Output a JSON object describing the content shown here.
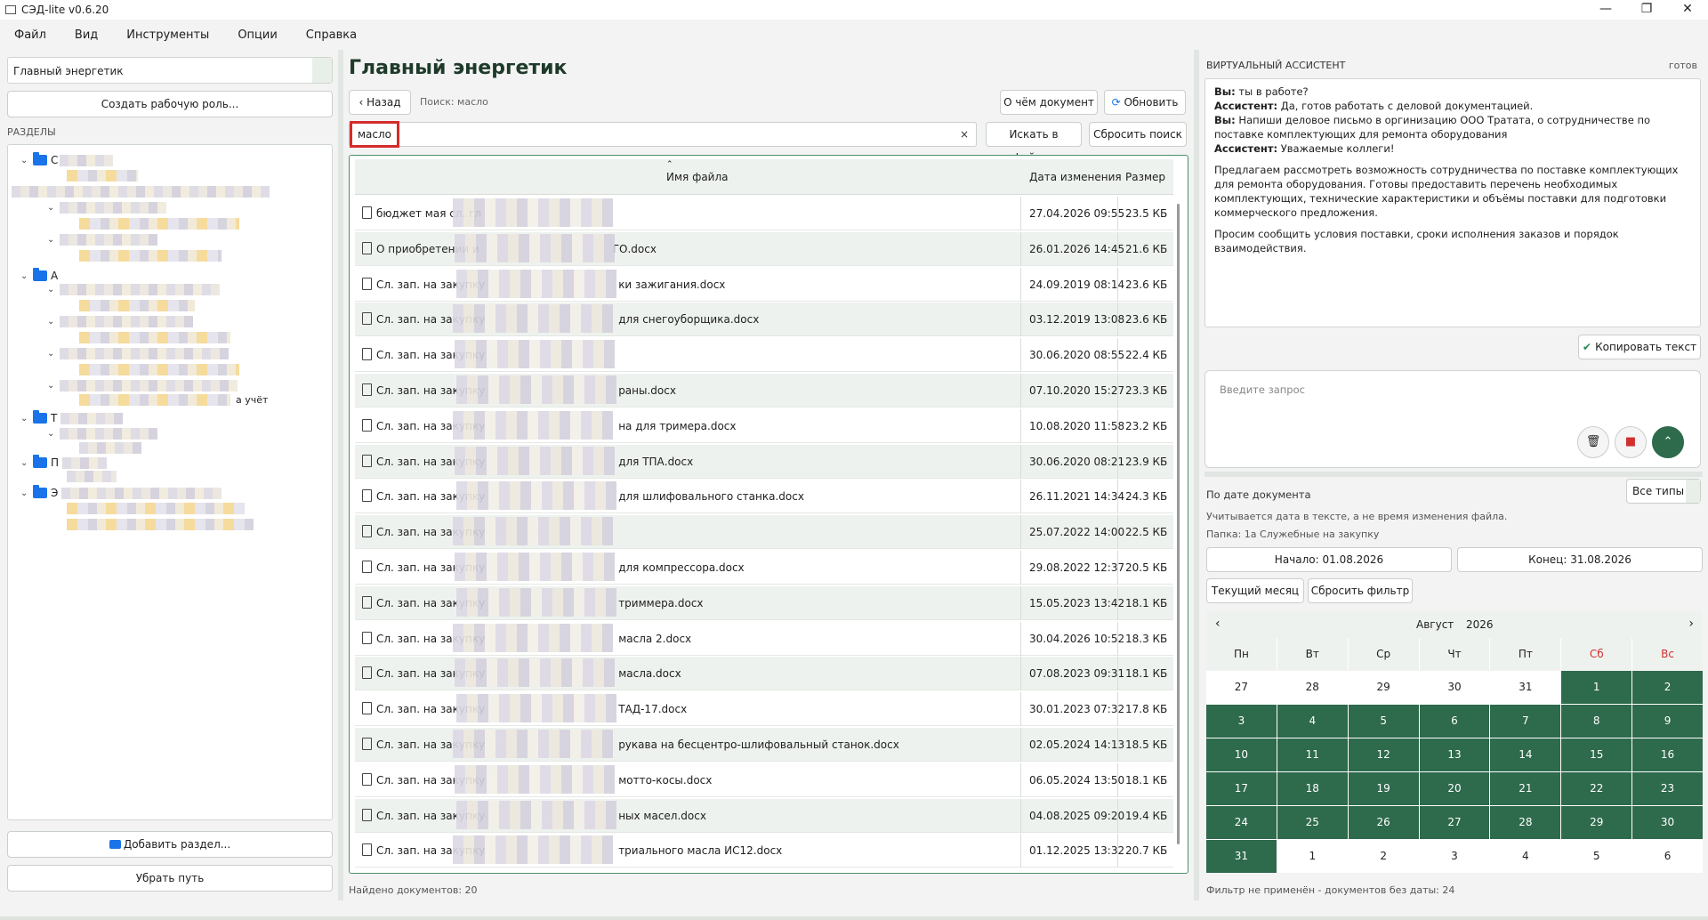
{
  "window": {
    "title": "СЭД-lite v0.6.20",
    "minimize": "—",
    "maximize": "❐",
    "close": "✕"
  },
  "menu": [
    "Файл",
    "Вид",
    "Инструменты",
    "Опции",
    "Справка"
  ],
  "left": {
    "role_value": "Главный энергетик",
    "create_role": "Создать рабочую роль...",
    "sections_label": "РАЗДЕЛЫ",
    "tree_fragments": [
      "С",
      "А",
      "Т",
      "П",
      "Э",
      "а учёт"
    ],
    "add_section": "Добавить раздел...",
    "remove_path": "Убрать путь"
  },
  "center": {
    "title": "Главный энергетик",
    "back": "Назад",
    "search_hint": "Поиск: масло",
    "about": "О чём документ",
    "refresh": "Обновить",
    "search_value": "масло",
    "clear": "×",
    "search_files": "Искать в файлах",
    "reset_search": "Сбросить поиск",
    "columns": {
      "name": "Имя файла",
      "date": "Дата изменения",
      "size": "Размер"
    },
    "rows": [
      {
        "prefix": "бюджет мая сл. гл",
        "suffix": "",
        "date": "27.04.2026 09:55",
        "size": "23.5 КБ"
      },
      {
        "prefix": "О приобретении и",
        "suffix": "ГО.docx",
        "date": "26.01.2026 14:45",
        "size": "21.6 КБ"
      },
      {
        "prefix": "Сл. зап. на закупку",
        "suffix": "ки зажигания.docx",
        "date": "24.09.2019 08:14",
        "size": "23.6 КБ"
      },
      {
        "prefix": "Сл. зап. на закупку",
        "suffix": "для снегоуборщика.docx",
        "date": "03.12.2019 13:08",
        "size": "23.6 КБ"
      },
      {
        "prefix": "Сл. зап. на закупку",
        "suffix": "",
        "date": "30.06.2020 08:55",
        "size": "22.4 КБ"
      },
      {
        "prefix": "Сл. зап. на закупку",
        "suffix": "раны.docx",
        "date": "07.10.2020 15:27",
        "size": "23.3 КБ"
      },
      {
        "prefix": "Сл. зап. на закупку",
        "suffix": "на для тримера.docx",
        "date": "10.08.2020 11:58",
        "size": "23.2 КБ"
      },
      {
        "prefix": "Сл. зап. на закупку",
        "suffix": "для ТПА.docx",
        "date": "30.06.2020 08:21",
        "size": "23.9 КБ"
      },
      {
        "prefix": "Сл. зап. на закупку",
        "suffix": "для шлифовального станка.docx",
        "date": "26.11.2021 14:34",
        "size": "24.3 КБ"
      },
      {
        "prefix": "Сл. зап. на закупку",
        "suffix": "",
        "date": "25.07.2022 14:00",
        "size": "22.5 КБ"
      },
      {
        "prefix": "Сл. зап. на закупку",
        "suffix": "для компрессора.docx",
        "date": "29.08.2022 12:37",
        "size": "20.5 КБ"
      },
      {
        "prefix": "Сл. зап. на закупку",
        "suffix": "триммера.docx",
        "date": "15.05.2023 13:42",
        "size": "18.1 КБ"
      },
      {
        "prefix": "Сл. зап. на закупку",
        "suffix": "масла 2.docx",
        "date": "30.04.2026 10:52",
        "size": "18.3 КБ"
      },
      {
        "prefix": "Сл. зап. на закупку",
        "suffix": "масла.docx",
        "date": "07.08.2023 09:31",
        "size": "18.1 КБ"
      },
      {
        "prefix": "Сл. зап. на закупку",
        "suffix": "ТАД-17.docx",
        "date": "30.01.2023 07:32",
        "size": "17.8 КБ"
      },
      {
        "prefix": "Сл. зап. на закупку",
        "suffix": "рукава на бесцентро-шлифовальный станок.docx",
        "date": "02.05.2024 14:13",
        "size": "18.5 КБ"
      },
      {
        "prefix": "Сл. зап. на закупку",
        "suffix": "мотто-косы.docx",
        "date": "06.05.2024 13:50",
        "size": "18.1 КБ"
      },
      {
        "prefix": "Сл. зап. на закупку",
        "suffix": "ных масел.docx",
        "date": "04.08.2025 09:20",
        "size": "19.4 КБ"
      },
      {
        "prefix": "Сл. зап. на закупку",
        "suffix": "триального масла ИС12.docx",
        "date": "01.12.2025 13:32",
        "size": "20.7 КБ"
      }
    ],
    "found": "Найдено документов: 20"
  },
  "assistant": {
    "label": "ВИРТУАЛЬНЫЙ АССИСТЕНТ",
    "status": "готов",
    "messages": [
      {
        "who": "Вы:",
        "text": " ты в работе?"
      },
      {
        "who": "Ассистент:",
        "text": " Да, готов работать с деловой документацией."
      },
      {
        "who": "Вы:",
        "text": " Напиши деловое письмо в оргинизацию ООО Тратата, о сотрудничестве по поставке комплектующих для ремонта оборудования"
      },
      {
        "who": "Ассистент:",
        "text": " Уважаемые коллеги!"
      }
    ],
    "para1": "Предлагаем рассмотреть возможность сотрудничества по поставке комплектующих для ремонта оборудования. Готовы предоставить перечень необходимых комплектующих, технические характеристики и объёмы поставки для подготовки коммерческого предложения.",
    "para2": "Просим сообщить условия поставки, сроки исполнения заказов и порядок взаимодействия.",
    "copy": "Копировать текст",
    "prompt_placeholder": "Введите запрос"
  },
  "dates": {
    "by_date": "По дате документа",
    "all_types": "Все типы",
    "note": "Учитывается дата в тексте, а не время изменения файла.",
    "folder": "Папка: 1а Служебные на закупку",
    "start": "Начало: 01.08.2026",
    "end": "Конец: 31.08.2026",
    "current_month": "Текущий месяц",
    "reset_filter": "Сбросить фильтр",
    "month": "Август",
    "year": "2026",
    "dows": [
      "Пн",
      "Вт",
      "Ср",
      "Чт",
      "Пт",
      "Сб",
      "Вс"
    ],
    "days": [
      {
        "d": "27",
        "in": false
      },
      {
        "d": "28",
        "in": false
      },
      {
        "d": "29",
        "in": false
      },
      {
        "d": "30",
        "in": false
      },
      {
        "d": "31",
        "in": false
      },
      {
        "d": "1",
        "in": true
      },
      {
        "d": "2",
        "in": true
      },
      {
        "d": "3",
        "in": true
      },
      {
        "d": "4",
        "in": true
      },
      {
        "d": "5",
        "in": true
      },
      {
        "d": "6",
        "in": true
      },
      {
        "d": "7",
        "in": true
      },
      {
        "d": "8",
        "in": true
      },
      {
        "d": "9",
        "in": true
      },
      {
        "d": "10",
        "in": true
      },
      {
        "d": "11",
        "in": true
      },
      {
        "d": "12",
        "in": true
      },
      {
        "d": "13",
        "in": true
      },
      {
        "d": "14",
        "in": true
      },
      {
        "d": "15",
        "in": true
      },
      {
        "d": "16",
        "in": true
      },
      {
        "d": "17",
        "in": true
      },
      {
        "d": "18",
        "in": true
      },
      {
        "d": "19",
        "in": true
      },
      {
        "d": "20",
        "in": true
      },
      {
        "d": "21",
        "in": true
      },
      {
        "d": "22",
        "in": true
      },
      {
        "d": "23",
        "in": true
      },
      {
        "d": "24",
        "in": true
      },
      {
        "d": "25",
        "in": true
      },
      {
        "d": "26",
        "in": true
      },
      {
        "d": "27",
        "in": true
      },
      {
        "d": "28",
        "in": true
      },
      {
        "d": "29",
        "in": true
      },
      {
        "d": "30",
        "in": true
      },
      {
        "d": "31",
        "in": true
      },
      {
        "d": "1",
        "in": false
      },
      {
        "d": "2",
        "in": false
      },
      {
        "d": "3",
        "in": false
      },
      {
        "d": "4",
        "in": false
      },
      {
        "d": "5",
        "in": false
      },
      {
        "d": "6",
        "in": false
      }
    ],
    "filter_note": "Фильтр не применён - документов без даты: 24"
  },
  "colors": {
    "accent": "#2e6a4c",
    "highlight": "#d62b2b",
    "weekend": "#d03030"
  }
}
